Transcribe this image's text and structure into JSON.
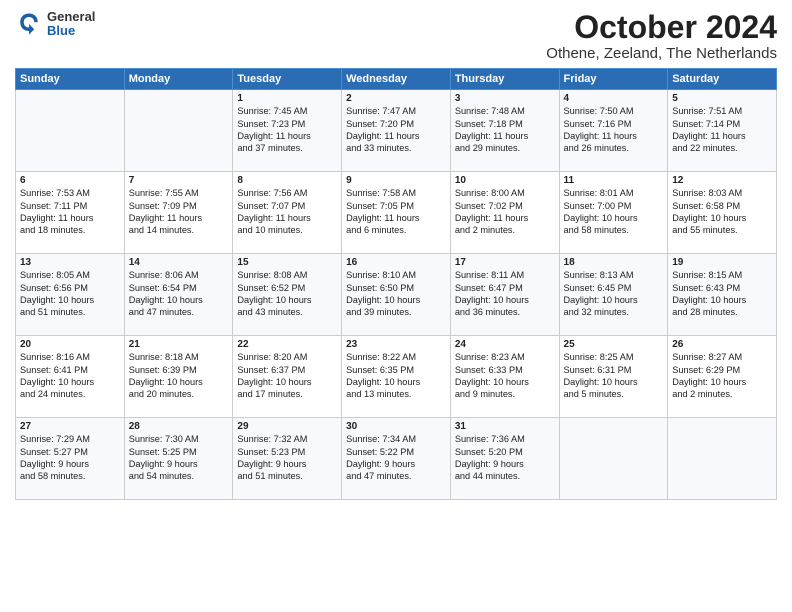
{
  "header": {
    "logo_general": "General",
    "logo_blue": "Blue",
    "month": "October 2024",
    "location": "Othene, Zeeland, The Netherlands"
  },
  "weekdays": [
    "Sunday",
    "Monday",
    "Tuesday",
    "Wednesday",
    "Thursday",
    "Friday",
    "Saturday"
  ],
  "weeks": [
    [
      {
        "day": "",
        "info": ""
      },
      {
        "day": "",
        "info": ""
      },
      {
        "day": "1",
        "info": "Sunrise: 7:45 AM\nSunset: 7:23 PM\nDaylight: 11 hours\nand 37 minutes."
      },
      {
        "day": "2",
        "info": "Sunrise: 7:47 AM\nSunset: 7:20 PM\nDaylight: 11 hours\nand 33 minutes."
      },
      {
        "day": "3",
        "info": "Sunrise: 7:48 AM\nSunset: 7:18 PM\nDaylight: 11 hours\nand 29 minutes."
      },
      {
        "day": "4",
        "info": "Sunrise: 7:50 AM\nSunset: 7:16 PM\nDaylight: 11 hours\nand 26 minutes."
      },
      {
        "day": "5",
        "info": "Sunrise: 7:51 AM\nSunset: 7:14 PM\nDaylight: 11 hours\nand 22 minutes."
      }
    ],
    [
      {
        "day": "6",
        "info": "Sunrise: 7:53 AM\nSunset: 7:11 PM\nDaylight: 11 hours\nand 18 minutes."
      },
      {
        "day": "7",
        "info": "Sunrise: 7:55 AM\nSunset: 7:09 PM\nDaylight: 11 hours\nand 14 minutes."
      },
      {
        "day": "8",
        "info": "Sunrise: 7:56 AM\nSunset: 7:07 PM\nDaylight: 11 hours\nand 10 minutes."
      },
      {
        "day": "9",
        "info": "Sunrise: 7:58 AM\nSunset: 7:05 PM\nDaylight: 11 hours\nand 6 minutes."
      },
      {
        "day": "10",
        "info": "Sunrise: 8:00 AM\nSunset: 7:02 PM\nDaylight: 11 hours\nand 2 minutes."
      },
      {
        "day": "11",
        "info": "Sunrise: 8:01 AM\nSunset: 7:00 PM\nDaylight: 10 hours\nand 58 minutes."
      },
      {
        "day": "12",
        "info": "Sunrise: 8:03 AM\nSunset: 6:58 PM\nDaylight: 10 hours\nand 55 minutes."
      }
    ],
    [
      {
        "day": "13",
        "info": "Sunrise: 8:05 AM\nSunset: 6:56 PM\nDaylight: 10 hours\nand 51 minutes."
      },
      {
        "day": "14",
        "info": "Sunrise: 8:06 AM\nSunset: 6:54 PM\nDaylight: 10 hours\nand 47 minutes."
      },
      {
        "day": "15",
        "info": "Sunrise: 8:08 AM\nSunset: 6:52 PM\nDaylight: 10 hours\nand 43 minutes."
      },
      {
        "day": "16",
        "info": "Sunrise: 8:10 AM\nSunset: 6:50 PM\nDaylight: 10 hours\nand 39 minutes."
      },
      {
        "day": "17",
        "info": "Sunrise: 8:11 AM\nSunset: 6:47 PM\nDaylight: 10 hours\nand 36 minutes."
      },
      {
        "day": "18",
        "info": "Sunrise: 8:13 AM\nSunset: 6:45 PM\nDaylight: 10 hours\nand 32 minutes."
      },
      {
        "day": "19",
        "info": "Sunrise: 8:15 AM\nSunset: 6:43 PM\nDaylight: 10 hours\nand 28 minutes."
      }
    ],
    [
      {
        "day": "20",
        "info": "Sunrise: 8:16 AM\nSunset: 6:41 PM\nDaylight: 10 hours\nand 24 minutes."
      },
      {
        "day": "21",
        "info": "Sunrise: 8:18 AM\nSunset: 6:39 PM\nDaylight: 10 hours\nand 20 minutes."
      },
      {
        "day": "22",
        "info": "Sunrise: 8:20 AM\nSunset: 6:37 PM\nDaylight: 10 hours\nand 17 minutes."
      },
      {
        "day": "23",
        "info": "Sunrise: 8:22 AM\nSunset: 6:35 PM\nDaylight: 10 hours\nand 13 minutes."
      },
      {
        "day": "24",
        "info": "Sunrise: 8:23 AM\nSunset: 6:33 PM\nDaylight: 10 hours\nand 9 minutes."
      },
      {
        "day": "25",
        "info": "Sunrise: 8:25 AM\nSunset: 6:31 PM\nDaylight: 10 hours\nand 5 minutes."
      },
      {
        "day": "26",
        "info": "Sunrise: 8:27 AM\nSunset: 6:29 PM\nDaylight: 10 hours\nand 2 minutes."
      }
    ],
    [
      {
        "day": "27",
        "info": "Sunrise: 7:29 AM\nSunset: 5:27 PM\nDaylight: 9 hours\nand 58 minutes."
      },
      {
        "day": "28",
        "info": "Sunrise: 7:30 AM\nSunset: 5:25 PM\nDaylight: 9 hours\nand 54 minutes."
      },
      {
        "day": "29",
        "info": "Sunrise: 7:32 AM\nSunset: 5:23 PM\nDaylight: 9 hours\nand 51 minutes."
      },
      {
        "day": "30",
        "info": "Sunrise: 7:34 AM\nSunset: 5:22 PM\nDaylight: 9 hours\nand 47 minutes."
      },
      {
        "day": "31",
        "info": "Sunrise: 7:36 AM\nSunset: 5:20 PM\nDaylight: 9 hours\nand 44 minutes."
      },
      {
        "day": "",
        "info": ""
      },
      {
        "day": "",
        "info": ""
      }
    ]
  ]
}
